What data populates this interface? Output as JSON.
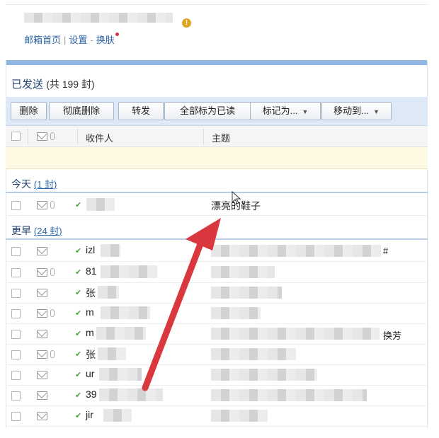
{
  "header": {
    "account_text": "",
    "links": [
      "邮箱首页",
      "设置",
      "换肤"
    ],
    "separator": "|",
    "dash": "-",
    "warning_symbol": "!"
  },
  "folder": {
    "name": "已发送",
    "count_text": "(共 199 封)"
  },
  "toolbar": {
    "buttons": [
      "删除",
      "彻底删除",
      "转发",
      "全部标为已读",
      "标记为...",
      "移动到..."
    ],
    "caret": "▼"
  },
  "columns": {
    "recipient": "收件人",
    "subject": "主题"
  },
  "groups": [
    {
      "name": "今天",
      "count": "(1 封)"
    },
    {
      "name": "更早",
      "count": "(24 封)"
    }
  ],
  "today_rows": [
    {
      "recipient": "",
      "subject": "漂亮的鞋子",
      "attachment": true
    }
  ],
  "earlier_rows": [
    {
      "recipient": "izl",
      "subject": "",
      "tail": "#",
      "attachment": false
    },
    {
      "recipient": "81",
      "subject": "",
      "tail": "",
      "attachment": true
    },
    {
      "recipient": "张",
      "subject": "",
      "tail": "",
      "attachment": false
    },
    {
      "recipient": "m",
      "subject": "",
      "tail": "",
      "attachment": true
    },
    {
      "recipient": "m",
      "subject": "",
      "tail": "换芳",
      "attachment": false
    },
    {
      "recipient": "张",
      "subject": "",
      "tail": "",
      "attachment": true
    },
    {
      "recipient": "ur",
      "subject": "",
      "tail": "",
      "attachment": false
    },
    {
      "recipient": "39",
      "subject": "",
      "tail": "",
      "attachment": false
    },
    {
      "recipient": "jir",
      "subject": "",
      "tail": "",
      "attachment": false
    }
  ],
  "check_symbol": "✔",
  "colors": {
    "accent": "#1f3f6d",
    "link": "#2a64a8",
    "toolbar": "#dde9f6",
    "arrow": "#d8383e",
    "sent_check": "#4aa43b",
    "notice": "#fdf9e3"
  }
}
